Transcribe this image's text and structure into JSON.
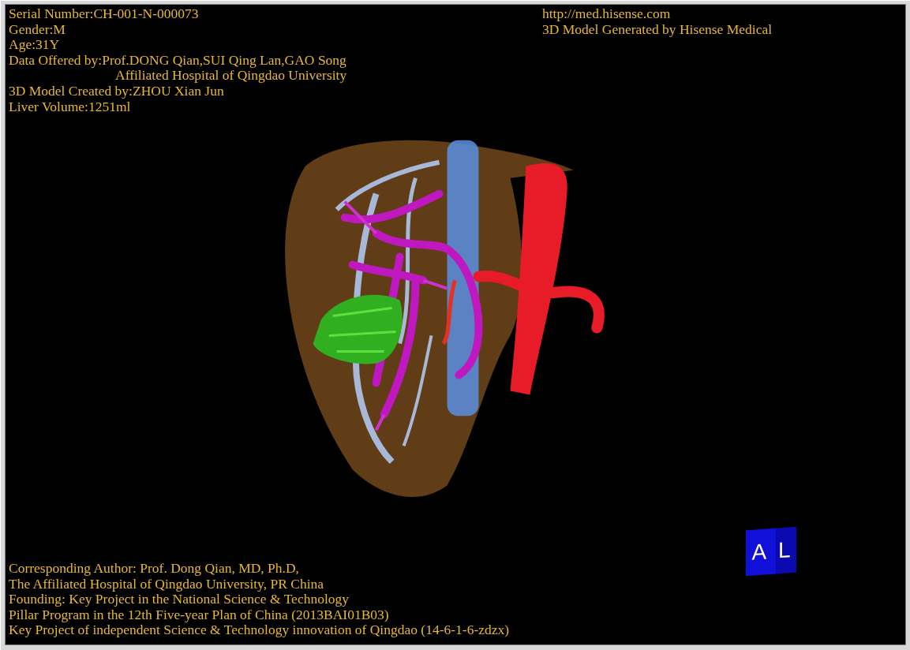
{
  "info_top_left": [
    {
      "kind": "line",
      "text": "Serial Number:CH-001-N-000073"
    },
    {
      "kind": "line",
      "text": "Gender:M"
    },
    {
      "kind": "line",
      "text": "Age:31Y"
    },
    {
      "kind": "line",
      "text": "Data Offered by:Prof.DONG Qian,SUI Qing Lan,GAO Song"
    },
    {
      "kind": "continuation",
      "text": "Affiliated Hospital of Qingdao University"
    },
    {
      "kind": "line",
      "text": "3D Model Created by:ZHOU Xian Jun"
    },
    {
      "kind": "line",
      "text": "Liver Volume:1251ml"
    }
  ],
  "info_top_right": [
    "http://med.hisense.com",
    "3D Model Generated by Hisense Medical"
  ],
  "info_bottom_left": [
    "Corresponding Author: Prof. Dong Qian, MD, Ph.D,",
    "The Affiliated Hospital of Qingdao University, PR China",
    "Founding: Key Project in the National Science & Technology",
    "Pillar Program in the 12th Five-year Plan of China (2013BAI01B03)",
    "Key Project of independent Science & Technology innovation of Qingdao (14-6-1-6-zdzx)"
  ],
  "orientation_cube": {
    "labels": [
      "A",
      "L"
    ]
  }
}
